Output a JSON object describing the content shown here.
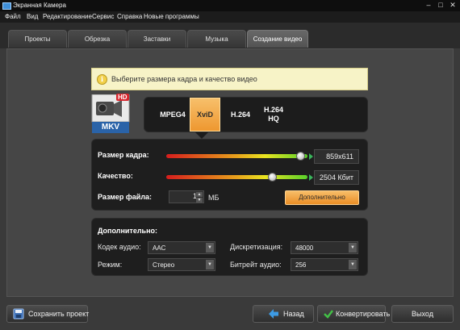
{
  "window": {
    "title": "Экранная Камера",
    "controls": [
      "–",
      "□",
      "✕"
    ]
  },
  "menu": [
    "Файл",
    "Вид",
    "Редактирование",
    "Сервис",
    "Справка",
    "Новые программы"
  ],
  "tabs": [
    {
      "label": "Проекты"
    },
    {
      "label": "Обрезка"
    },
    {
      "label": "Заставки"
    },
    {
      "label": "Музыка"
    },
    {
      "label": "Создание видео",
      "active": true
    }
  ],
  "hint": {
    "icon": "info-icon",
    "text": "Выберите размера кадра и качество видео"
  },
  "format": {
    "badge": "HD",
    "name": "MKV"
  },
  "codecs": [
    {
      "label": "MPEG4"
    },
    {
      "label": "XviD",
      "active": true
    },
    {
      "label": "H.264"
    },
    {
      "label": "H.264\nHQ"
    }
  ],
  "settings": {
    "frame_size": {
      "label": "Размер кадра:",
      "value": "859x611",
      "level": 0.95
    },
    "quality": {
      "label": "Качество:",
      "value": "2504 Кбит",
      "level": 0.75
    },
    "file_size": {
      "label": "Размер файла:",
      "value": "1",
      "unit": "МБ"
    },
    "more_button": "Дополнительно"
  },
  "advanced": {
    "title": "Дополнительно:",
    "audio_codec": {
      "label": "Кодек аудио:",
      "value": "AAC"
    },
    "sample_rate": {
      "label": "Дискретизация:",
      "value": "48000"
    },
    "mode": {
      "label": "Режим:",
      "value": "Стерео"
    },
    "audio_bitrate": {
      "label": "Битрейт аудио:",
      "value": "256"
    }
  },
  "footer": {
    "save": "Сохранить проект",
    "back": "Назад",
    "convert": "Конвертировать",
    "exit": "Выход"
  },
  "colors": {
    "accent": "#f0a23a",
    "panel": "#1e1e1e",
    "background": "#3a3a3a"
  }
}
